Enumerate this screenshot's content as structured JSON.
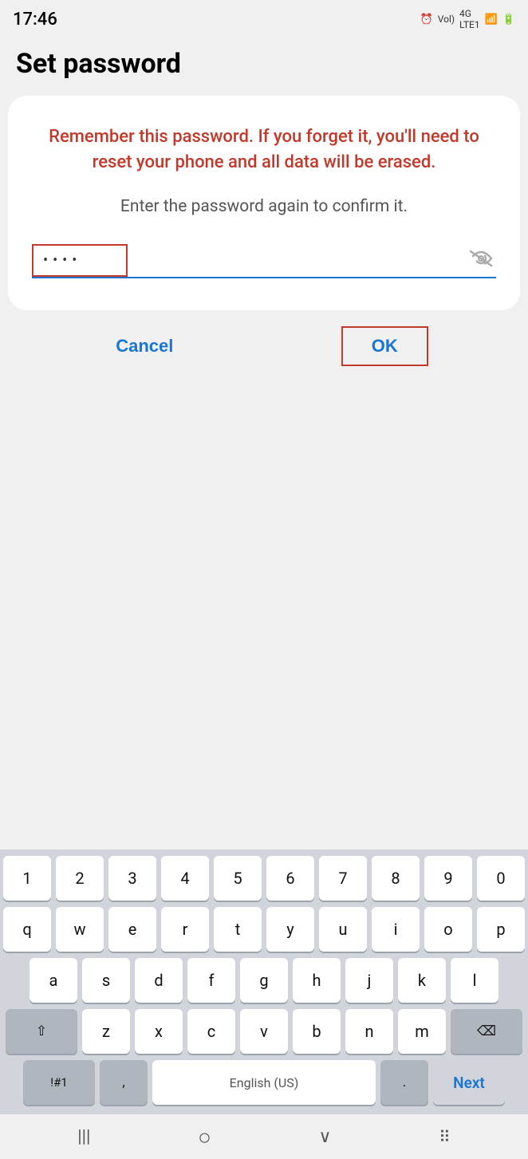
{
  "status_bar": {
    "time": "17:46",
    "icons": "⏰ Vol 4G ▲▼ 📷"
  },
  "page": {
    "title": "Set password"
  },
  "card": {
    "warning": "Remember this password. If you forget it, you'll need to reset your phone and all data will be erased.",
    "instruction": "Enter the password again to confirm it.",
    "password_dots": "••••",
    "toggle_icon": "👁"
  },
  "buttons": {
    "cancel": "Cancel",
    "ok": "OK"
  },
  "keyboard": {
    "row1": [
      "1",
      "2",
      "3",
      "4",
      "5",
      "6",
      "7",
      "8",
      "9",
      "0"
    ],
    "row2": [
      "q",
      "w",
      "e",
      "r",
      "t",
      "y",
      "u",
      "i",
      "o",
      "p"
    ],
    "row3": [
      "a",
      "s",
      "d",
      "f",
      "g",
      "h",
      "j",
      "k",
      "l"
    ],
    "row4_special_left": "⇧",
    "row4": [
      "z",
      "x",
      "c",
      "v",
      "b",
      "n",
      "m"
    ],
    "row4_delete": "⌫",
    "row5_symbols": "!#1",
    "row5_comma": ",",
    "row5_space": "English (US)",
    "row5_period": ".",
    "row5_next": "Next"
  },
  "nav": {
    "back": "|||",
    "home": "○",
    "recent": "∨",
    "apps": "⠿"
  }
}
